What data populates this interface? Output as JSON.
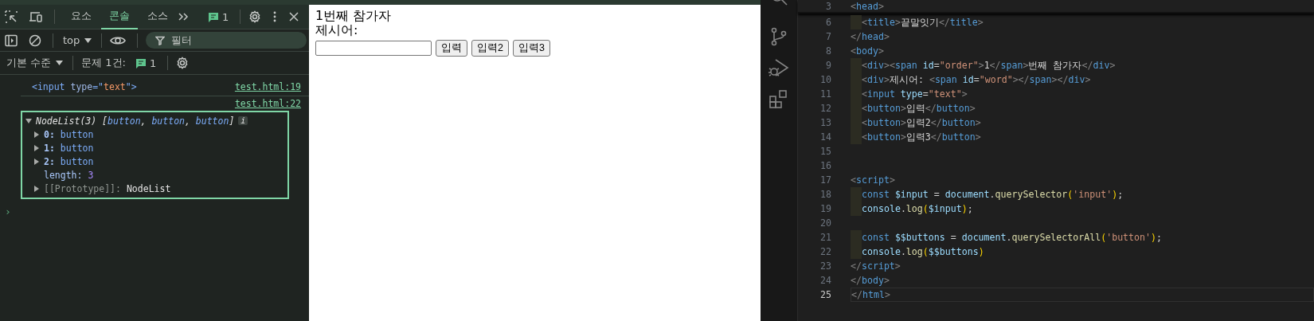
{
  "devtools": {
    "tabs": [
      {
        "label": "요소",
        "selected": false
      },
      {
        "label": "콘솔",
        "selected": true
      },
      {
        "label": "소스",
        "selected": false
      }
    ],
    "issues_badge": "1",
    "context": "top",
    "filter": {
      "placeholder": "필터"
    },
    "level_menu": "기본 수준",
    "issues_label": "문제 1건:",
    "issues_count": "1",
    "console": [
      {
        "kind": "element",
        "tokens": [
          {
            "kind": "tag",
            "text": "<input"
          },
          {
            "kind": "attr",
            "text": " type"
          },
          {
            "kind": "tag",
            "text": "=\""
          },
          {
            "kind": "str",
            "text": "text"
          },
          {
            "kind": "tag",
            "text": "\">"
          }
        ],
        "source": "test.html:19"
      },
      {
        "kind": "object",
        "source": "test.html:22",
        "outlined": true,
        "expanded": true,
        "header": [
          {
            "kind": "name",
            "text": "NodeList(3) "
          },
          {
            "kind": "p",
            "text": "["
          },
          {
            "kind": "val",
            "text": "button"
          },
          {
            "kind": "p",
            "text": ", "
          },
          {
            "kind": "val",
            "text": "button"
          },
          {
            "kind": "p",
            "text": ", "
          },
          {
            "kind": "val",
            "text": "button"
          },
          {
            "kind": "p",
            "text": "]"
          }
        ],
        "info": "i",
        "children": [
          {
            "kind": "node",
            "key": "0:",
            "value": "button",
            "expandable": true
          },
          {
            "kind": "node",
            "key": "1:",
            "value": "button",
            "expandable": true
          },
          {
            "kind": "node",
            "key": "2:",
            "value": "button",
            "expandable": true
          },
          {
            "kind": "number",
            "key": "length:",
            "value": "3",
            "expandable": false
          },
          {
            "kind": "internal",
            "key": "[[Prototype]]:",
            "value": "NodeList",
            "expandable": true
          }
        ]
      }
    ],
    "prompt": "›"
  },
  "page": {
    "lines": [
      "1번째 참가자",
      "제시어:"
    ],
    "buttons": [
      "입력",
      "입력2",
      "입력3"
    ]
  },
  "editor": {
    "sticky": {
      "number": "3",
      "tokens": [
        {
          "kind": "p",
          "text": "<"
        },
        {
          "kind": "tag",
          "text": "head"
        },
        {
          "kind": "p",
          "text": ">"
        }
      ]
    },
    "lines": [
      {
        "number": "6",
        "indented": true,
        "current": false,
        "tokens": [
          {
            "kind": "p",
            "text": "<"
          },
          {
            "kind": "tag",
            "text": "title"
          },
          {
            "kind": "p",
            "text": ">"
          },
          {
            "kind": "text",
            "text": "끝말잇기"
          },
          {
            "kind": "p",
            "text": "</"
          },
          {
            "kind": "tag",
            "text": "title"
          },
          {
            "kind": "p",
            "text": ">"
          }
        ]
      },
      {
        "number": "7",
        "indented": false,
        "current": false,
        "tokens": [
          {
            "kind": "p",
            "text": "</"
          },
          {
            "kind": "tag",
            "text": "head"
          },
          {
            "kind": "p",
            "text": ">"
          }
        ]
      },
      {
        "number": "8",
        "indented": false,
        "current": false,
        "tokens": [
          {
            "kind": "p",
            "text": "<"
          },
          {
            "kind": "tag",
            "text": "body"
          },
          {
            "kind": "p",
            "text": ">"
          }
        ]
      },
      {
        "number": "9",
        "indented": true,
        "current": false,
        "tokens": [
          {
            "kind": "p",
            "text": "<"
          },
          {
            "kind": "tag",
            "text": "div"
          },
          {
            "kind": "p",
            "text": "><"
          },
          {
            "kind": "tag",
            "text": "span"
          },
          {
            "kind": "attr",
            "text": " id"
          },
          {
            "kind": "op",
            "text": "="
          },
          {
            "kind": "str",
            "text": "\"order\""
          },
          {
            "kind": "p",
            "text": ">"
          },
          {
            "kind": "text",
            "text": "1"
          },
          {
            "kind": "p",
            "text": "</"
          },
          {
            "kind": "tag",
            "text": "span"
          },
          {
            "kind": "p",
            "text": ">"
          },
          {
            "kind": "text",
            "text": "번째 참가자"
          },
          {
            "kind": "p",
            "text": "</"
          },
          {
            "kind": "tag",
            "text": "div"
          },
          {
            "kind": "p",
            "text": ">"
          }
        ]
      },
      {
        "number": "10",
        "indented": true,
        "current": false,
        "tokens": [
          {
            "kind": "p",
            "text": "<"
          },
          {
            "kind": "tag",
            "text": "div"
          },
          {
            "kind": "p",
            "text": ">"
          },
          {
            "kind": "text",
            "text": "제시어: "
          },
          {
            "kind": "p",
            "text": "<"
          },
          {
            "kind": "tag",
            "text": "span"
          },
          {
            "kind": "attr",
            "text": " id"
          },
          {
            "kind": "op",
            "text": "="
          },
          {
            "kind": "str",
            "text": "\"word\""
          },
          {
            "kind": "p",
            "text": "></"
          },
          {
            "kind": "tag",
            "text": "span"
          },
          {
            "kind": "p",
            "text": "></"
          },
          {
            "kind": "tag",
            "text": "div"
          },
          {
            "kind": "p",
            "text": ">"
          }
        ]
      },
      {
        "number": "11",
        "indented": true,
        "current": false,
        "tokens": [
          {
            "kind": "p",
            "text": "<"
          },
          {
            "kind": "tag",
            "text": "input"
          },
          {
            "kind": "attr",
            "text": " type"
          },
          {
            "kind": "op",
            "text": "="
          },
          {
            "kind": "str",
            "text": "\"text\""
          },
          {
            "kind": "p",
            "text": ">"
          }
        ]
      },
      {
        "number": "12",
        "indented": true,
        "current": false,
        "tokens": [
          {
            "kind": "p",
            "text": "<"
          },
          {
            "kind": "tag",
            "text": "button"
          },
          {
            "kind": "p",
            "text": ">"
          },
          {
            "kind": "text",
            "text": "입력"
          },
          {
            "kind": "p",
            "text": "</"
          },
          {
            "kind": "tag",
            "text": "button"
          },
          {
            "kind": "p",
            "text": ">"
          }
        ]
      },
      {
        "number": "13",
        "indented": true,
        "current": false,
        "tokens": [
          {
            "kind": "p",
            "text": "<"
          },
          {
            "kind": "tag",
            "text": "button"
          },
          {
            "kind": "p",
            "text": ">"
          },
          {
            "kind": "text",
            "text": "입력2"
          },
          {
            "kind": "p",
            "text": "</"
          },
          {
            "kind": "tag",
            "text": "button"
          },
          {
            "kind": "p",
            "text": ">"
          }
        ]
      },
      {
        "number": "14",
        "indented": true,
        "current": false,
        "tokens": [
          {
            "kind": "p",
            "text": "<"
          },
          {
            "kind": "tag",
            "text": "button"
          },
          {
            "kind": "p",
            "text": ">"
          },
          {
            "kind": "text",
            "text": "입력3"
          },
          {
            "kind": "p",
            "text": "</"
          },
          {
            "kind": "tag",
            "text": "button"
          },
          {
            "kind": "p",
            "text": ">"
          }
        ]
      },
      {
        "number": "15",
        "indented": false,
        "current": false
      },
      {
        "number": "16",
        "indented": false,
        "current": false
      },
      {
        "number": "17",
        "indented": false,
        "current": false,
        "tokens": [
          {
            "kind": "p",
            "text": "<"
          },
          {
            "kind": "tag",
            "text": "script"
          },
          {
            "kind": "p",
            "text": ">"
          }
        ]
      },
      {
        "number": "18",
        "indented": true,
        "current": false,
        "tokens": [
          {
            "kind": "kw",
            "text": "const "
          },
          {
            "kind": "var",
            "text": "$input"
          },
          {
            "kind": "op",
            "text": " = "
          },
          {
            "kind": "var",
            "text": "document"
          },
          {
            "kind": "op",
            "text": "."
          },
          {
            "kind": "fn",
            "text": "querySelector"
          },
          {
            "kind": "br",
            "text": "("
          },
          {
            "kind": "str",
            "text": "'input'"
          },
          {
            "kind": "br",
            "text": ")"
          },
          {
            "kind": "op",
            "text": ";"
          }
        ]
      },
      {
        "number": "19",
        "indented": true,
        "current": false,
        "tokens": [
          {
            "kind": "var",
            "text": "console"
          },
          {
            "kind": "op",
            "text": "."
          },
          {
            "kind": "fn",
            "text": "log"
          },
          {
            "kind": "br",
            "text": "("
          },
          {
            "kind": "var",
            "text": "$input"
          },
          {
            "kind": "br",
            "text": ")"
          },
          {
            "kind": "op",
            "text": ";"
          }
        ]
      },
      {
        "number": "20",
        "indented": false,
        "current": false
      },
      {
        "number": "21",
        "indented": true,
        "current": false,
        "tokens": [
          {
            "kind": "kw",
            "text": "const "
          },
          {
            "kind": "var",
            "text": "$$buttons"
          },
          {
            "kind": "op",
            "text": " = "
          },
          {
            "kind": "var",
            "text": "document"
          },
          {
            "kind": "op",
            "text": "."
          },
          {
            "kind": "fn",
            "text": "querySelectorAll"
          },
          {
            "kind": "br",
            "text": "("
          },
          {
            "kind": "str",
            "text": "'button'"
          },
          {
            "kind": "br",
            "text": ")"
          },
          {
            "kind": "op",
            "text": ";"
          }
        ]
      },
      {
        "number": "22",
        "indented": true,
        "current": false,
        "tokens": [
          {
            "kind": "var",
            "text": "console"
          },
          {
            "kind": "op",
            "text": "."
          },
          {
            "kind": "fn",
            "text": "log"
          },
          {
            "kind": "br",
            "text": "("
          },
          {
            "kind": "var",
            "text": "$$buttons"
          },
          {
            "kind": "br",
            "text": ")"
          }
        ]
      },
      {
        "number": "23",
        "indented": false,
        "current": false,
        "tokens": [
          {
            "kind": "p",
            "text": "</"
          },
          {
            "kind": "tag",
            "text": "script"
          },
          {
            "kind": "p",
            "text": ">"
          }
        ]
      },
      {
        "number": "24",
        "indented": false,
        "current": false,
        "tokens": [
          {
            "kind": "p",
            "text": "</"
          },
          {
            "kind": "tag",
            "text": "body"
          },
          {
            "kind": "p",
            "text": ">"
          }
        ]
      },
      {
        "number": "25",
        "indented": false,
        "current": true,
        "tokens": [
          {
            "kind": "p",
            "text": "</"
          },
          {
            "kind": "tag",
            "text": "html"
          },
          {
            "kind": "p",
            "text": ">"
          }
        ]
      }
    ]
  }
}
